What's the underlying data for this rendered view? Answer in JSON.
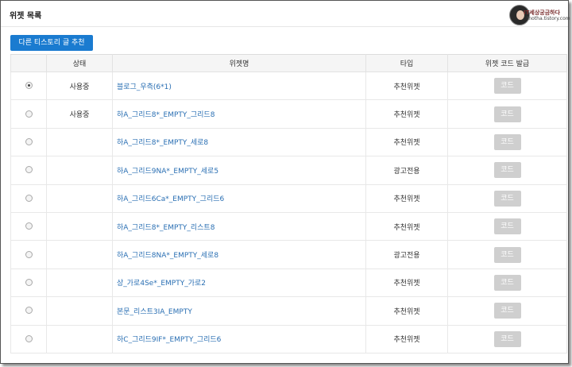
{
  "header": {
    "title": "위젯 목록",
    "watermark_line1": "IT세상궁금하다",
    "watermark_line2": "tnotha.tistory.com"
  },
  "recommend_button": "다른 티스토리 글 추천",
  "table": {
    "columns": [
      "",
      "상태",
      "위젯명",
      "타입",
      "위젯 코드 발급"
    ],
    "rows": [
      {
        "selected": true,
        "status": "사용중",
        "name": "블로그_우측(6*1)",
        "type": "추천위젯",
        "code": "코드"
      },
      {
        "selected": false,
        "status": "사용중",
        "name": "하A_그리드8*_EMPTY_그리드8",
        "type": "추천위젯",
        "code": "코드"
      },
      {
        "selected": false,
        "status": "",
        "name": "하A_그리드8*_EMPTY_세로8",
        "type": "추천위젯",
        "code": "코드"
      },
      {
        "selected": false,
        "status": "",
        "name": "하A_그리드9NA*_EMPTY_세로5",
        "type": "광고전용",
        "code": "코드"
      },
      {
        "selected": false,
        "status": "",
        "name": "하A_그리드6Ca*_EMPTY_그리드6",
        "type": "추천위젯",
        "code": "코드"
      },
      {
        "selected": false,
        "status": "",
        "name": "하A_그리드8*_EMPTY_리스트8",
        "type": "추천위젯",
        "code": "코드"
      },
      {
        "selected": false,
        "status": "",
        "name": "하A_그리드8NA*_EMPTY_세로8",
        "type": "광고전용",
        "code": "코드"
      },
      {
        "selected": false,
        "status": "",
        "name": "상_가로4Se*_EMPTY_가로2",
        "type": "추천위젯",
        "code": "코드"
      },
      {
        "selected": false,
        "status": "",
        "name": "본문_리스트3IA_EMPTY",
        "type": "추천위젯",
        "code": "코드"
      },
      {
        "selected": false,
        "status": "",
        "name": "하C_그리드9IF*_EMPTY_그리드6",
        "type": "추천위젯",
        "code": "코드"
      }
    ]
  }
}
